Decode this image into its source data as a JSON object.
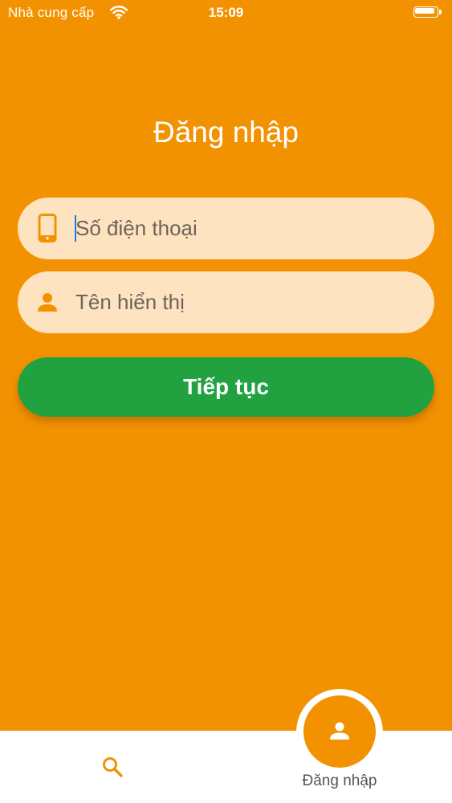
{
  "status_bar": {
    "carrier": "Nhà cung cấp",
    "time": "15:09",
    "icons": [
      "wifi-icon",
      "battery-icon"
    ]
  },
  "login": {
    "title": "Đăng nhập",
    "phone": {
      "placeholder": "Số điện thoại",
      "value": "",
      "icon": "phone-icon"
    },
    "name": {
      "placeholder": "Tên hiển thị",
      "value": "",
      "icon": "user-icon"
    },
    "continue_label": "Tiếp tục"
  },
  "bottom_nav": {
    "items": [
      {
        "icon": "search-icon",
        "label": ""
      },
      {
        "icon": "user-icon",
        "label": "Đăng nhập",
        "active": true
      }
    ]
  },
  "colors": {
    "background": "#F39200",
    "field_background": "#FDE3BF",
    "button": "#22A140",
    "caret": "#1E7BE0"
  }
}
